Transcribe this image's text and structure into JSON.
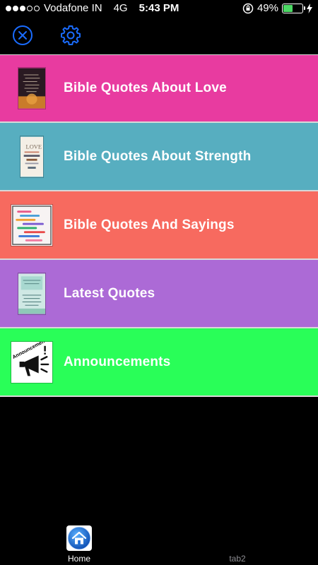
{
  "status_bar": {
    "carrier": "Vodafone IN",
    "network": "4G",
    "time": "5:43 PM",
    "battery": "49%",
    "battery_level": 0.49
  },
  "nav": {
    "close_icon": "close-circle-icon",
    "settings_icon": "gear-icon",
    "accent": "#1a6cff"
  },
  "menu": {
    "items": [
      {
        "label": "Bible Quotes About Love",
        "color": "#e83ba0"
      },
      {
        "label": "Bible Quotes About Strength",
        "color": "#57aec0"
      },
      {
        "label": "Bible Quotes And Sayings",
        "color": "#f76a5f"
      },
      {
        "label": "Latest Quotes",
        "color": "#ac6ad6"
      },
      {
        "label": "Announcements",
        "color": "#29fe58"
      }
    ],
    "announcements_thumb_text": "Announcements"
  },
  "tabs": {
    "home": "Home",
    "tab2": "tab2"
  }
}
